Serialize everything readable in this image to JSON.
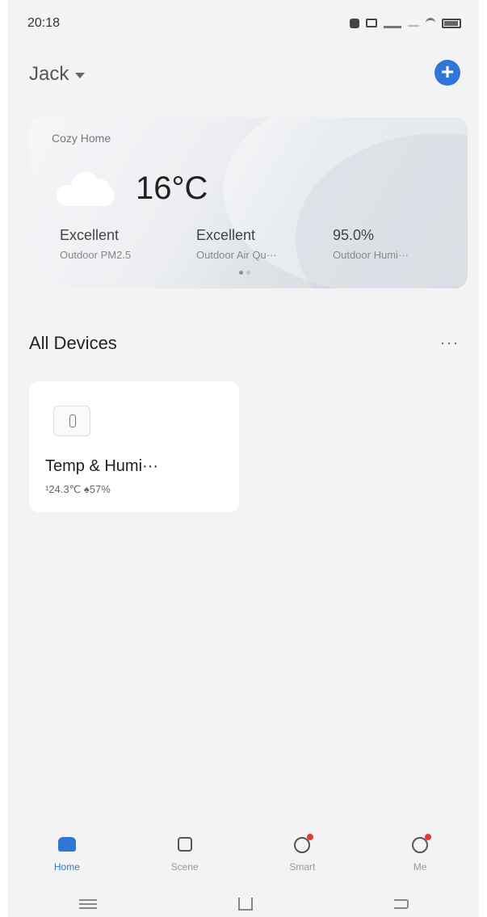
{
  "status_bar": {
    "time": "20:18",
    "icons": [
      "shield-icon",
      "notification-icon",
      "signal-icon",
      "dash-icon",
      "wifi-icon",
      "battery-icon"
    ]
  },
  "header": {
    "user_name": "Jack",
    "add_icon": "plus-icon",
    "accent_color": "#2f76d6"
  },
  "weather_card": {
    "home_name": "Cozy Home",
    "temperature": "16°C",
    "weather_icon": "cloud-icon",
    "metrics": [
      {
        "value": "Excellent",
        "label": "Outdoor PM2.5"
      },
      {
        "value": "Excellent",
        "label": "Outdoor Air Qu···"
      },
      {
        "value": "95.0%",
        "label": "Outdoor Humi···"
      }
    ],
    "page_indicator": {
      "count": 2,
      "active": 1
    }
  },
  "devices_section": {
    "title": "All Devices",
    "more_label": "···",
    "devices": [
      {
        "name": "Temp & Humi···",
        "stats": "¹24.3℃  ♠57%",
        "icon": "thermometer-icon"
      }
    ]
  },
  "bottom_nav": {
    "items": [
      {
        "label": "Home",
        "icon": "home-icon",
        "active": true,
        "badge": false
      },
      {
        "label": "Scene",
        "icon": "scene-icon",
        "active": false,
        "badge": false
      },
      {
        "label": "Smart",
        "icon": "smart-icon",
        "active": false,
        "badge": true
      },
      {
        "label": "Me",
        "icon": "profile-icon",
        "active": false,
        "badge": true
      }
    ]
  },
  "system_nav": [
    "menu-icon",
    "home-outline-icon",
    "back-icon"
  ]
}
